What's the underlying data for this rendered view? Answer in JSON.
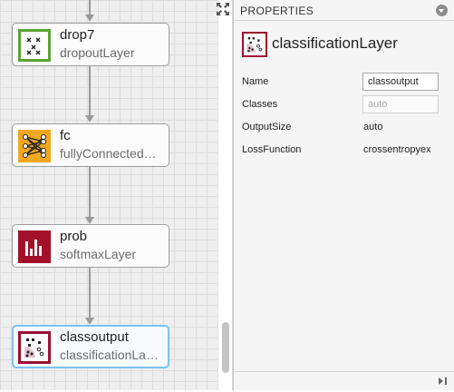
{
  "canvas": {
    "nodes": [
      {
        "name": "drop7",
        "type": "dropoutLayer",
        "icon": "dropout-icon",
        "color": "#5aa332"
      },
      {
        "name": "fc",
        "type": "fullyConnected…",
        "icon": "fully-connected-icon",
        "color": "#f2a81e"
      },
      {
        "name": "prob",
        "type": "softmaxLayer",
        "icon": "softmax-icon",
        "color": "#a3102a"
      },
      {
        "name": "classoutput",
        "type": "classificationLa…",
        "icon": "classification-icon",
        "color": "#9c1030",
        "selected": true
      }
    ]
  },
  "properties": {
    "header": "PROPERTIES",
    "layer_type": "classificationLayer",
    "fields": {
      "name_label": "Name",
      "name_value": "classoutput",
      "classes_label": "Classes",
      "classes_value": "auto",
      "outputsize_label": "OutputSize",
      "outputsize_value": "auto",
      "lossfunction_label": "LossFunction",
      "lossfunction_value": "crossentropyex"
    }
  },
  "colors": {
    "selection_border": "#7cc2ef",
    "dropout": "#5aa332",
    "fully_connected": "#f2a81e",
    "softmax": "#a3102a",
    "classification": "#9c1030"
  }
}
